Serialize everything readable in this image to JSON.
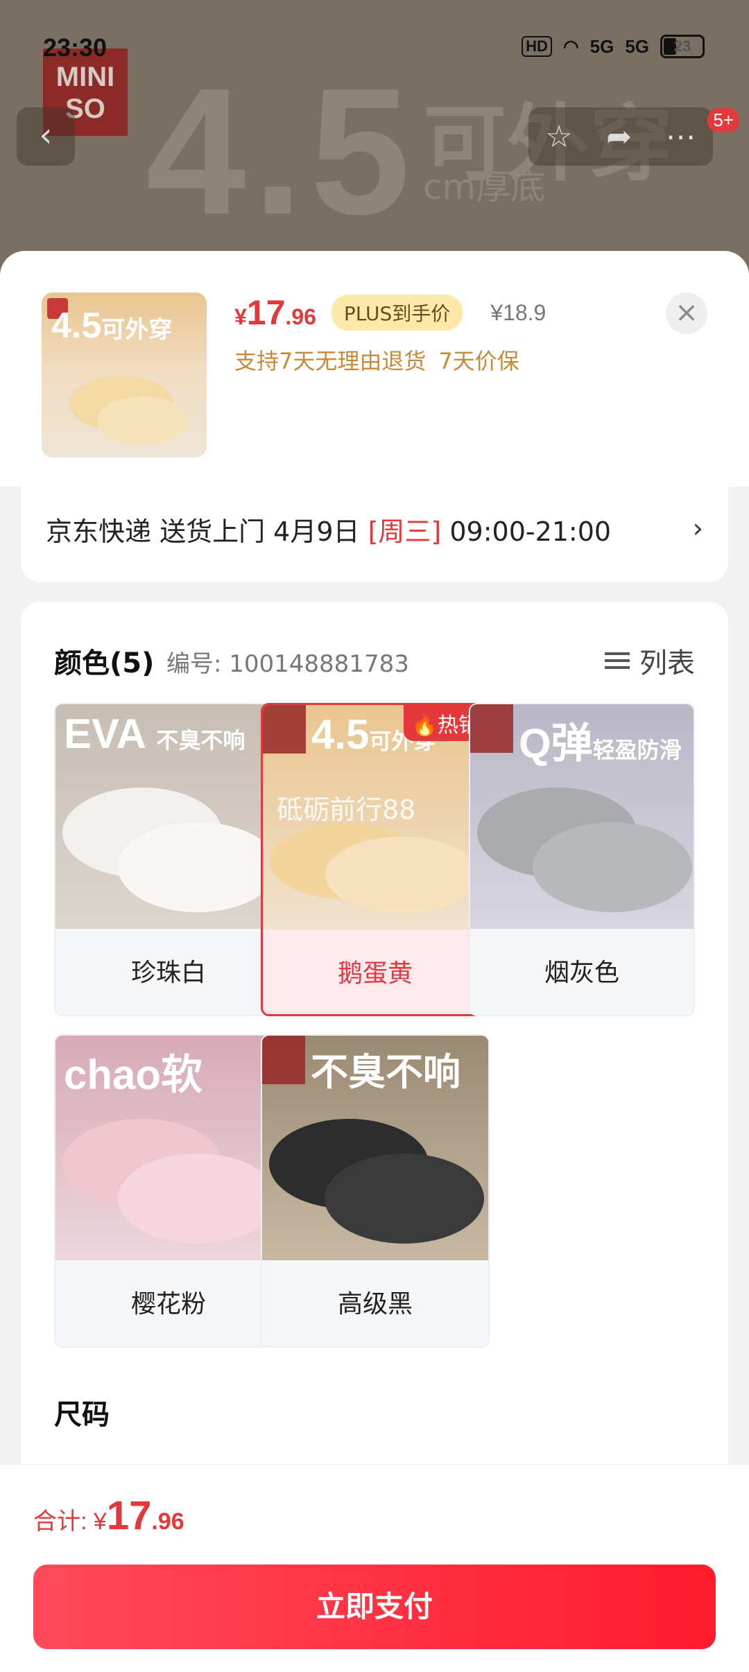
{
  "status": {
    "time": "23:30",
    "hd": "HD",
    "network1": "5G",
    "network2": "5G",
    "battery": "23"
  },
  "background": {
    "hero_number": "4.5",
    "hero_cn": "可外穿",
    "hero_sub": "cm厚底",
    "logo": "MINISO",
    "notification_badge": "5+"
  },
  "product": {
    "thumb_text_big": "4.5",
    "thumb_text_cn": "可外穿",
    "price_symbol": "¥",
    "price_int": "17",
    "price_dec": ".96",
    "plus_label": "PLUS到手价",
    "original_price": "¥18.9",
    "service_tags": [
      "支持7天无理由退货",
      "7天价保"
    ]
  },
  "delivery": {
    "carrier": "京东快递 送货上门 4月9日",
    "weekday": "[周三]",
    "time_window": "09:00-21:00"
  },
  "spec": {
    "color_title": "颜色(5)",
    "item_code": "编号: 100148881783",
    "list_toggle": "列表",
    "size_title": "尺码",
    "options": [
      {
        "label": "珍珠白",
        "overlay": "EVA",
        "overlay_small": "不臭不响",
        "hot": ""
      },
      {
        "label": "鹅蛋黄",
        "overlay": "4.5",
        "overlay_small": "可外穿",
        "hot": "热销",
        "watermark": "砥砺前行88"
      },
      {
        "label": "烟灰色",
        "overlay": "Q弹",
        "overlay_small": "轻盈防滑",
        "hot": ""
      },
      {
        "label": "樱花粉",
        "overlay": "chao软",
        "overlay_small": "",
        "hot": ""
      },
      {
        "label": "高级黑",
        "overlay": "不臭不响",
        "overlay_small": "",
        "hot": ""
      }
    ]
  },
  "bottom": {
    "total_label": "合计:",
    "total_symbol": "¥",
    "total_int": "17",
    "total_dec": ".96",
    "pay_button": "立即支付"
  },
  "colors": {
    "accent": "#e4393c",
    "plus_bg": "#fde9a9",
    "service": "#c78a3a"
  }
}
